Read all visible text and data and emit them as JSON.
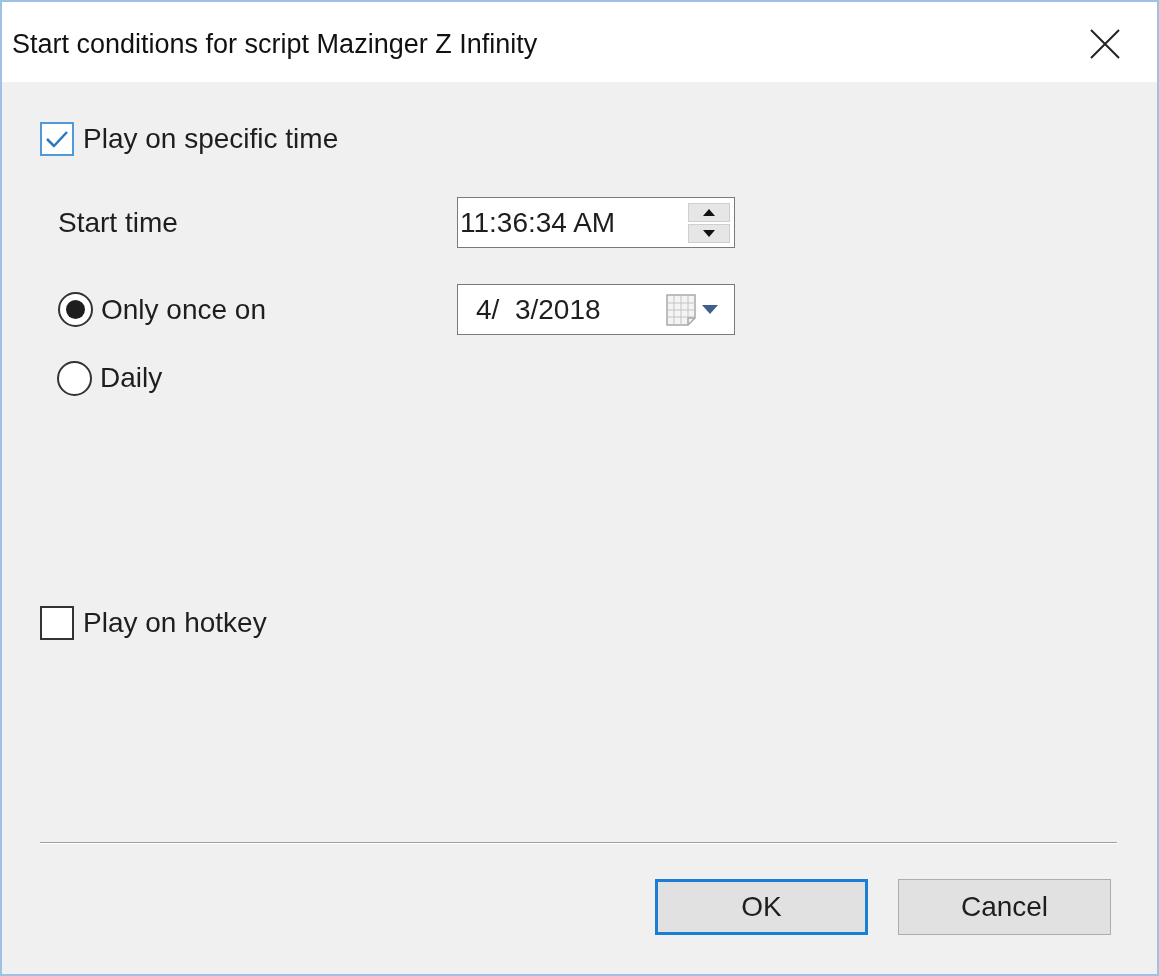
{
  "window": {
    "title": "Start conditions for script Mazinger Z Infinity"
  },
  "specific_time": {
    "label": "Play on specific time",
    "checked": true
  },
  "start_time": {
    "label": "Start time",
    "value": "11:36:34 AM"
  },
  "schedule": [
    {
      "label": "Only once on",
      "selected": true,
      "date": "4/  3/2018"
    },
    {
      "label": "Daily",
      "selected": false
    }
  ],
  "hotkey": {
    "label": "Play on hotkey",
    "checked": false
  },
  "buttons": [
    {
      "label": "OK",
      "default": true
    },
    {
      "label": "Cancel",
      "default": false
    }
  ]
}
